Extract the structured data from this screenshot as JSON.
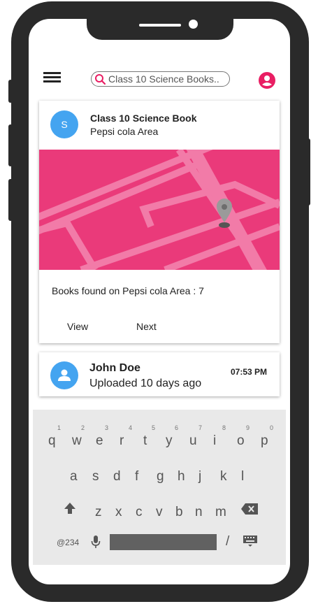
{
  "search": {
    "value": "Class 10 Science Books.."
  },
  "result_card": {
    "avatar_letter": "S",
    "title": "Class 10 Science Book",
    "subtitle": "Pepsi cola Area",
    "books_found": "Books found on Pepsi cola Area : 7",
    "view_label": "View",
    "next_label": "Next",
    "map_color": "#ea3a7a"
  },
  "upload_card": {
    "name": "John Doe",
    "status": "Uploaded 10 days ago",
    "time": "07:53 PM"
  },
  "keyboard": {
    "numbers": [
      "1",
      "2",
      "3",
      "4",
      "5",
      "6",
      "7",
      "8",
      "9",
      "0"
    ],
    "row1": [
      "q",
      "w",
      "e",
      "r",
      "t",
      "y",
      "u",
      "i",
      "o",
      "p"
    ],
    "row2": [
      "a",
      "s",
      "d",
      "f",
      "g",
      "h",
      "j",
      "k",
      "l"
    ],
    "row3": [
      "z",
      "x",
      "c",
      "v",
      "b",
      "n",
      "m"
    ],
    "sym_label": "@234",
    "slash": "/"
  },
  "colors": {
    "accent": "#e91e63",
    "avatar_blue": "#44a4f0",
    "phone_frame": "#2a2a2a"
  }
}
